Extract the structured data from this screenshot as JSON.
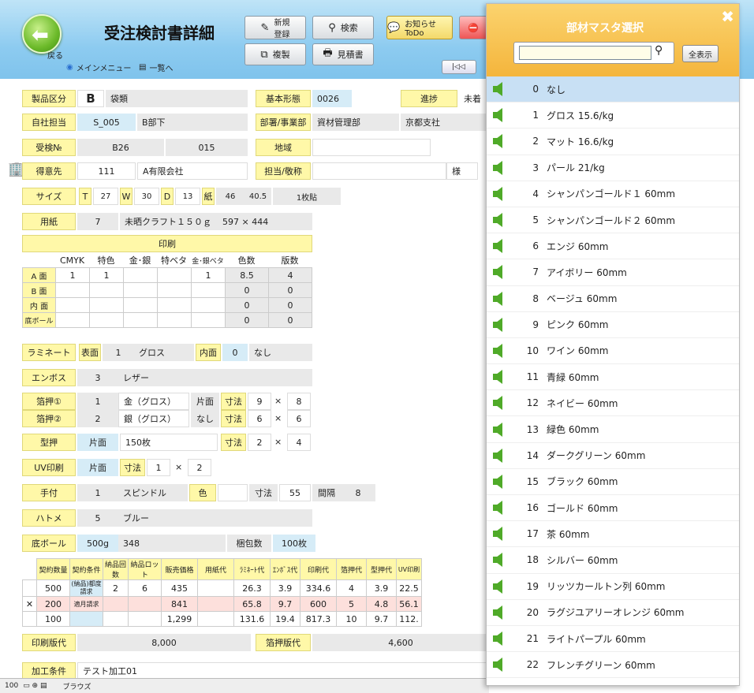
{
  "header": {
    "title": "受注検討書詳細",
    "back": "戻る",
    "main_menu": "メインメニュー",
    "list": "一覧へ",
    "btn_new": "新規\n登録",
    "btn_search": "検索",
    "btn_notice": "お知らせ ToDo",
    "btn_copy": "複製",
    "btn_estimate": "見積書"
  },
  "form": {
    "product_type_label": "製品区分",
    "product_type": "B",
    "product_type_name": "袋類",
    "basic_form_label": "基本形態",
    "basic_form": "0026",
    "progress_label": "進捗",
    "progress_val": "未着",
    "staff_label": "自社担当",
    "staff_code": "S_005",
    "staff_name": "B部下",
    "dept_label": "部署/事業部",
    "dept": "資材管理部",
    "branch": "京都支社",
    "order_no_label": "受検№",
    "order_no": "B26",
    "order_sub": "015",
    "region_label": "地域",
    "customer_label": "得意先",
    "customer_code": "111",
    "customer_name": "A有限会社",
    "contact_label": "担当/敬称",
    "honorific": "様",
    "size_label": "サイズ",
    "size_t": "T",
    "size_t_val": "27",
    "size_w": "W",
    "size_w_val": "30",
    "size_d": "D",
    "size_d_val": "13",
    "size_paper": "紙",
    "size_p1": "46",
    "size_p2": "40.5",
    "size_note": "1枚貼",
    "paper_label": "用紙",
    "paper_code": "7",
    "paper_name": "未晒クラフト１５０ｇ",
    "paper_size": "597 × 444",
    "print_label": "印刷",
    "print_cols": [
      "CMYK",
      "特色",
      "金･銀",
      "特ベタ",
      "金･銀ベタ",
      "色数",
      "版数"
    ],
    "print_rows": [
      {
        "name": "A 面",
        "vals": [
          "1",
          "1",
          "",
          "",
          "1",
          "8.5",
          "4"
        ]
      },
      {
        "name": "B 面",
        "vals": [
          "",
          "",
          "",
          "",
          "",
          "0",
          "0"
        ]
      },
      {
        "name": "内 面",
        "vals": [
          "",
          "",
          "",
          "",
          "",
          "0",
          "0"
        ]
      },
      {
        "name": "底ボール",
        "vals": [
          "",
          "",
          "",
          "",
          "",
          "0",
          "0"
        ]
      }
    ],
    "laminate_label": "ラミネート",
    "front_label": "表面",
    "front_val": "1",
    "front_name": "グロス",
    "inner_label": "内面",
    "inner_val": "0",
    "inner_name": "なし",
    "emboss_label": "エンボス",
    "emboss_val": "3",
    "emboss_name": "レザー",
    "foil1_label": "箔押①",
    "foil1_val": "1",
    "foil1_name": "金（グロス）",
    "foil1_side": "片面",
    "foil1_dim_label": "寸法",
    "foil1_w": "9",
    "foil1_h": "8",
    "foil2_label": "箔押②",
    "foil2_val": "2",
    "foil2_name": "銀（グロス）",
    "foil2_side": "なし",
    "foil2_dim_label": "寸法",
    "foil2_w": "6",
    "foil2_h": "6",
    "die_label": "型押",
    "die_side": "片面",
    "die_count": "150枚",
    "die_dim_label": "寸法",
    "die_w": "2",
    "die_h": "4",
    "uv_label": "UV印刷",
    "uv_side": "片面",
    "uv_dim_label": "寸法",
    "uv_w": "1",
    "uv_h": "2",
    "handle_label": "手付",
    "handle_val": "1",
    "handle_name": "スピンドル",
    "color_label": "色",
    "handle_dim_label": "寸法",
    "handle_dim": "55",
    "gap_label": "間隔",
    "gap_val": "8",
    "eyelet_label": "ハトメ",
    "eyelet_val": "5",
    "eyelet_name": "ブルー",
    "bottom_label": "底ボール",
    "bottom_val": "500g",
    "bottom_num": "348",
    "pack_label": "梱包数",
    "pack_val": "100枚",
    "qty_cols": [
      "契約数量",
      "契約条件",
      "納品回数",
      "納品ロット",
      "販売価格",
      "用紙代",
      "ﾗﾐﾈｰﾄ代",
      "ｴﾝﾎﾞｽ代",
      "印刷代",
      "箔押代",
      "型押代",
      "UV印刷"
    ],
    "qty_rows": [
      {
        "v": [
          "500",
          "(納品)都度請求",
          "2",
          "6",
          "435",
          "",
          "26.3",
          "3.9",
          "334.6",
          "4",
          "3.9",
          "22.5"
        ]
      },
      {
        "v": [
          "200",
          "適月請求",
          "",
          "",
          "841",
          "",
          "65.8",
          "9.7",
          "600",
          "5",
          "4.8",
          "56.1"
        ]
      },
      {
        "v": [
          "100",
          "",
          "",
          "",
          "1,299",
          "",
          "131.6",
          "19.4",
          "817.3",
          "10",
          "9.7",
          "112."
        ]
      }
    ],
    "plate_label": "印刷版代",
    "plate_val": "8,000",
    "foil_plate_label": "箔押版代",
    "foil_plate_val": "4,600",
    "process_label": "加工条件",
    "process_val": "テスト加工01"
  },
  "footer": {
    "zoom": "100",
    "mode": "ブラウズ"
  },
  "panel": {
    "title": "部材マスタ選択",
    "show_all": "全表示",
    "search_value": "",
    "items": [
      {
        "n": "0",
        "name": "なし"
      },
      {
        "n": "1",
        "name": "グロス 15.6/kg"
      },
      {
        "n": "2",
        "name": "マット 16.6/kg"
      },
      {
        "n": "3",
        "name": "パール 21/kg"
      },
      {
        "n": "4",
        "name": "シャンパンゴールド１ 60mm"
      },
      {
        "n": "5",
        "name": "シャンパンゴールド２ 60mm"
      },
      {
        "n": "6",
        "name": "エンジ 60mm"
      },
      {
        "n": "7",
        "name": "アイボリー 60mm"
      },
      {
        "n": "8",
        "name": "ベージュ 60mm"
      },
      {
        "n": "9",
        "name": "ピンク 60mm"
      },
      {
        "n": "10",
        "name": "ワイン 60mm"
      },
      {
        "n": "11",
        "name": "青緑 60mm"
      },
      {
        "n": "12",
        "name": "ネイビー 60mm"
      },
      {
        "n": "13",
        "name": "緑色 60mm"
      },
      {
        "n": "14",
        "name": "ダークグリーン 60mm"
      },
      {
        "n": "15",
        "name": "ブラック 60mm"
      },
      {
        "n": "16",
        "name": "ゴールド 60mm"
      },
      {
        "n": "17",
        "name": "茶 60mm"
      },
      {
        "n": "18",
        "name": "シルバー 60mm"
      },
      {
        "n": "19",
        "name": "リッツカールトン列 60mm"
      },
      {
        "n": "20",
        "name": "ラグジユアリーオレンジ 60mm"
      },
      {
        "n": "21",
        "name": "ライトパープル 60mm"
      },
      {
        "n": "22",
        "name": "フレンチグリーン 60mm"
      }
    ]
  }
}
